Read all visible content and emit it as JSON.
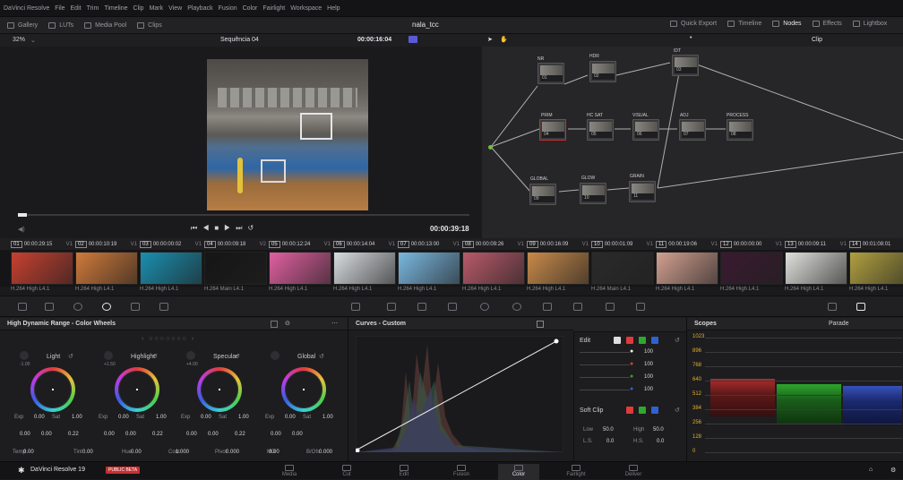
{
  "menu": [
    "DaVinci Resolve",
    "File",
    "Edit",
    "Trim",
    "Timeline",
    "Clip",
    "Mark",
    "View",
    "Playback",
    "Fusion",
    "Color",
    "Fairlight",
    "Workspace",
    "Help"
  ],
  "toolbar_left": [
    "Gallery",
    "LUTs",
    "Media Pool",
    "Clips"
  ],
  "toolbar_right": [
    "Quick Export",
    "Timeline",
    "Nodes",
    "Effects",
    "Lightbox"
  ],
  "project_title": "nala_tcc",
  "viewer": {
    "zoom": "32%",
    "sequence": "Sequência 04",
    "timecode_top": "00:00:16:04",
    "timecode_bottom": "00:00:39:18",
    "progress": 0.02
  },
  "node_editor": {
    "mode": "Clip",
    "nodes": [
      {
        "label": "NR",
        "num": "01"
      },
      {
        "label": "HDR",
        "num": "02"
      },
      {
        "label": "IDT",
        "num": "03"
      },
      {
        "label": "PRIM",
        "num": "04"
      },
      {
        "label": "HC SAT",
        "num": "05"
      },
      {
        "label": "VISUAL",
        "num": "06"
      },
      {
        "label": "ADJ",
        "num": "07"
      },
      {
        "label": "PROCESS",
        "num": "08"
      },
      {
        "label": "GLOBAL",
        "num": "09"
      },
      {
        "label": "GLOW",
        "num": "10"
      },
      {
        "label": "GRAIN",
        "num": "11"
      }
    ]
  },
  "clips": [
    {
      "n": "01",
      "tc": "00:00:29:15",
      "track": "V1",
      "codec": "H.264 High L4.1",
      "color": "#c84030"
    },
    {
      "n": "02",
      "tc": "00:00:10:19",
      "track": "V1",
      "codec": "H.264 High L4.1",
      "color": "#d07a3a"
    },
    {
      "n": "03",
      "tc": "00:00:00:02",
      "track": "V1",
      "codec": "H.264 High L4.1",
      "color": "#1a8fb0"
    },
    {
      "n": "04",
      "tc": "00:00:09:18",
      "track": "V2",
      "codec": "H.264 Main L4.1",
      "color": "#151515"
    },
    {
      "n": "05",
      "tc": "00:00:12:24",
      "track": "V1",
      "codec": "H.264 High L4.1",
      "color": "#e060a0"
    },
    {
      "n": "06",
      "tc": "00:00:14:04",
      "track": "V1",
      "codec": "H.264 High L4.1",
      "color": "#d8dce0"
    },
    {
      "n": "07",
      "tc": "00:00:13:00",
      "track": "V1",
      "codec": "H.264 High L4.1",
      "color": "#7ab8e0"
    },
    {
      "n": "08",
      "tc": "00:00:09:26",
      "track": "V1",
      "codec": "H.264 High L4.1",
      "color": "#b85a6a"
    },
    {
      "n": "09",
      "tc": "00:00:16:09",
      "track": "V1",
      "codec": "H.264 High L4.1",
      "color": "#c88a4a"
    },
    {
      "n": "10",
      "tc": "00:00:01:09",
      "track": "V1",
      "codec": "H.264 Main L4.1",
      "color": "#2a2a2a"
    },
    {
      "n": "11",
      "tc": "00:00:19:06",
      "track": "V1",
      "codec": "H.264 High L4.1",
      "color": "#d2a090"
    },
    {
      "n": "12",
      "tc": "00:00:00:00",
      "track": "V1",
      "codec": "H.264 High L4.1",
      "color": "#3a1a30"
    },
    {
      "n": "13",
      "tc": "00:00:09:11",
      "track": "V1",
      "codec": "H.264 High L4.1",
      "color": "#e0e0dc"
    },
    {
      "n": "14",
      "tc": "00:01:08:01",
      "track": "V1",
      "codec": "H.264 High L4.1",
      "color": "#b0a040"
    }
  ],
  "wheels_panel": {
    "title": "High Dynamic Range - Color Wheels",
    "wheels": [
      {
        "name": "Light",
        "zone": "-1.00",
        "exp": "0.00",
        "sat": "1.00",
        "x": "0.00",
        "y": "0.00",
        "z": "0.22"
      },
      {
        "name": "Highlight",
        "zone": "+1.50",
        "exp": "0.00",
        "sat": "1.00",
        "x": "0.00",
        "y": "0.00",
        "z": "0.22"
      },
      {
        "name": "Specular",
        "zone": "+4.00",
        "exp": "0.00",
        "sat": "1.00",
        "x": "0.00",
        "y": "0.00",
        "z": "0.22"
      },
      {
        "name": "Global",
        "zone": "",
        "exp": "0.00",
        "sat": "1.00",
        "x": "0.00",
        "y": "0.00",
        "z": ""
      }
    ],
    "labels": {
      "exp": "Exp",
      "sat": "Sat",
      "temp": "Temp",
      "tint": "Tint",
      "hue": "Hue",
      "cont": "Cont",
      "pivot": "Pivot",
      "md": "MD",
      "bofs": "B/Ofs"
    },
    "bottom": {
      "temp": "0.00",
      "tint": "0.00",
      "hue": "0.00",
      "cont": "1.000",
      "pivot": "0.000",
      "md": "0.00",
      "bofs": "0.000"
    }
  },
  "curves_panel": {
    "title": "Curves - Custom"
  },
  "edit_panel": {
    "edit_label": "Edit",
    "values": [
      "100",
      "100",
      "100",
      "100"
    ],
    "soft_clip": "Soft Clip",
    "low_label": "Low",
    "low": "50.0",
    "high_label": "High",
    "high": "50.0",
    "ls_label": "L.S.",
    "ls": "0.0",
    "hs_label": "H.S.",
    "hs": "0.0",
    "channels": [
      "Y",
      "R",
      "G",
      "B"
    ]
  },
  "scopes_panel": {
    "title": "Scopes",
    "mode": "Parade",
    "scale": [
      "1023",
      "896",
      "768",
      "640",
      "512",
      "384",
      "256",
      "128",
      "0"
    ]
  },
  "status": {
    "app": "DaVinci Resolve 19",
    "badge": "PUBLIC BETA",
    "pages": [
      "Media",
      "Cut",
      "Edit",
      "Fusion",
      "Color",
      "Fairlight",
      "Deliver"
    ],
    "active_page": "Color"
  },
  "colors": {
    "accent": "#e63a3a",
    "node_green": "#6fbf3a",
    "node_blue": "#3a8adf",
    "scale_yellow": "#e0b030"
  }
}
